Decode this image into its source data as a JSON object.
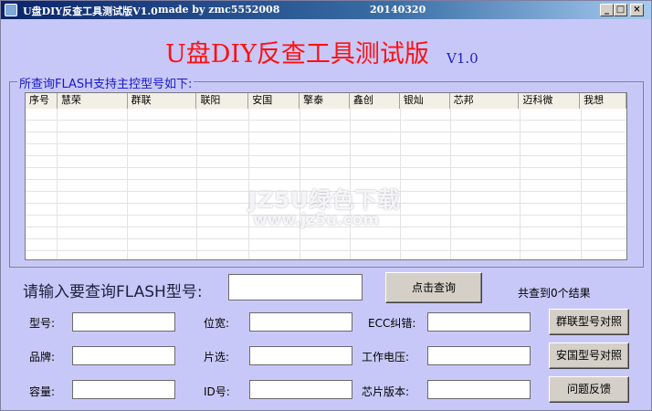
{
  "window": {
    "title": "U盘DIY反查工具测试版V1.0",
    "author": "made by zmc5552008",
    "date": "20140320",
    "minimize_glyph": "_",
    "maximize_glyph": "□",
    "close_glyph": "×"
  },
  "header": {
    "title": "U盘DIY反查工具测试版",
    "version": "V1.0"
  },
  "group": {
    "legend": "所查询FLASH支持主控型号如下:",
    "columns": [
      "序号",
      "慧荣",
      "群联",
      "联阳",
      "安国",
      "擎泰",
      "鑫创",
      "银灿",
      "芯邦",
      "迈科微",
      "我想"
    ]
  },
  "watermark": {
    "line1": "JZ5U绿色下载",
    "line2": "www.jz5u.com"
  },
  "search": {
    "label": "请输入要查询FLASH型号:",
    "value": "",
    "button": "点击查询",
    "result": "共查到0个结果"
  },
  "fields": {
    "model_label": "型号:",
    "bitwidth_label": "位宽:",
    "ecc_label": "ECC纠错:",
    "brand_label": "品牌:",
    "chipselect_label": "片选:",
    "voltage_label": "工作电压:",
    "capacity_label": "容量:",
    "id_label": "ID号:",
    "chipversion_label": "芯片版本:"
  },
  "buttons": {
    "phison": "群联型号对照",
    "alcor": "安国型号对照",
    "feedback": "问题反馈"
  },
  "colors": {
    "background": "#c8c8f8",
    "title_red": "#ff1010",
    "legend_blue": "#1818c8"
  }
}
